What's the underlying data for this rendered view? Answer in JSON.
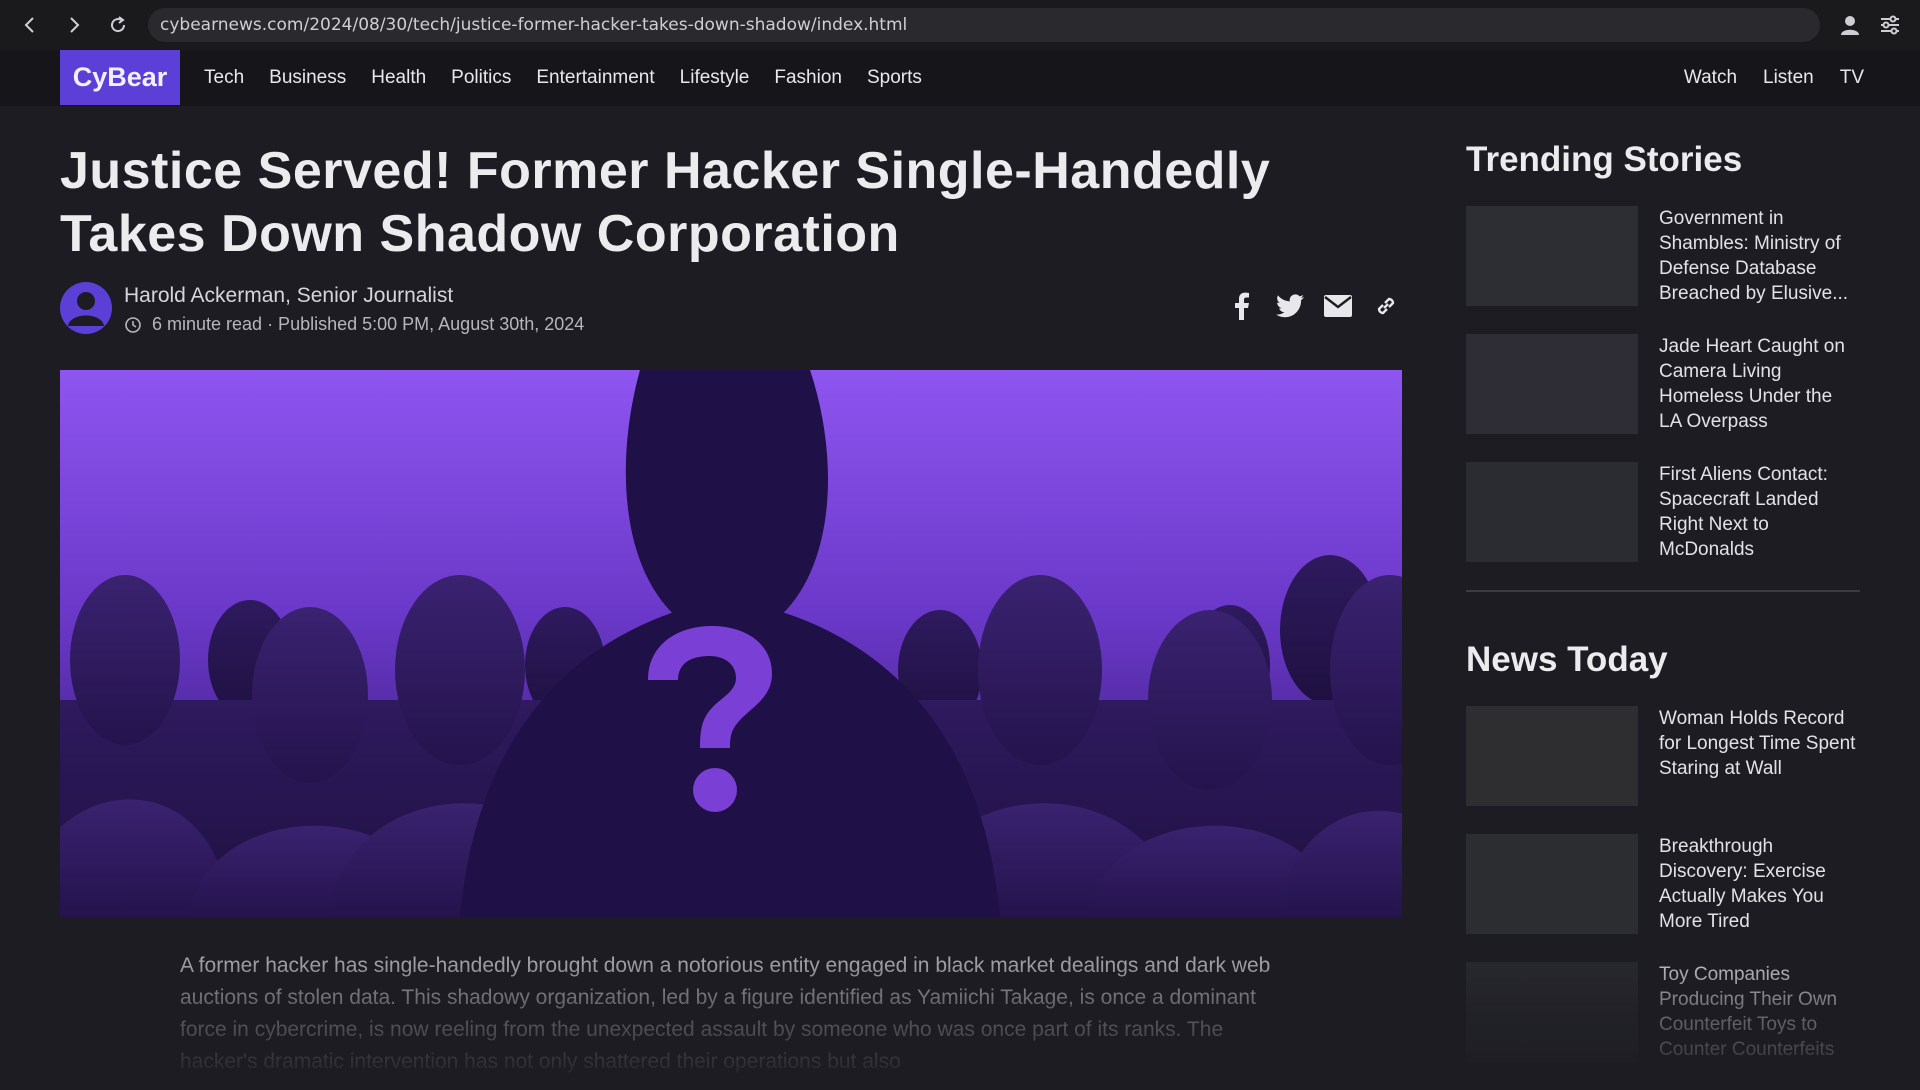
{
  "browser": {
    "url": "cybearnews.com/2024/08/30/tech/justice-former-hacker-takes-down-shadow/index.html"
  },
  "header": {
    "logo": "CyBear",
    "nav": [
      "Tech",
      "Business",
      "Health",
      "Politics",
      "Entertainment",
      "Lifestyle",
      "Fashion",
      "Sports"
    ],
    "nav_right": [
      "Watch",
      "Listen",
      "TV"
    ]
  },
  "article": {
    "headline": "Justice Served! Former Hacker Single-Handedly Takes Down Shadow Corporation",
    "author": "Harold Ackerman, Senior Journalist",
    "meta": "6 minute read · Published 5:00 PM, August 30th, 2024",
    "body": "A former hacker has single-handedly brought down a notorious entity engaged in black market dealings and dark web auctions of stolen data. This shadowy organization, led by a figure identified as Yamiichi Takage, is once a dominant force in cybercrime, is now reeling from the unexpected assault by someone who was once part of its ranks. The hacker's dramatic intervention has not only shattered their operations but also"
  },
  "sidebar": {
    "trending_title": "Trending Stories",
    "trending": [
      "Government in Shambles: Ministry of Defense Database Breached by Elusive...",
      "Jade Heart Caught on Camera Living Homeless Under the LA Overpass",
      "First Aliens Contact: Spacecraft Landed Right Next to McDonalds"
    ],
    "news_title": "News Today",
    "news": [
      "Woman Holds Record for Longest Time Spent Staring at Wall",
      "Breakthrough Discovery: Exercise Actually Makes You More Tired",
      "Toy Companies Producing Their Own Counterfeit Toys to Counter Counterfeits"
    ]
  },
  "colors": {
    "brand": "#5b3fd6",
    "background": "#1c1c22",
    "header": "#16161a",
    "hero_top": "#8e55f0",
    "hero_bottom": "#2a1460"
  },
  "icons": [
    "back-arrow-icon",
    "forward-arrow-icon",
    "reload-icon",
    "profile-icon",
    "settings-sliders-icon",
    "clock-icon",
    "facebook-icon",
    "twitter-icon",
    "email-icon",
    "link-icon",
    "question-mark-icon"
  ]
}
